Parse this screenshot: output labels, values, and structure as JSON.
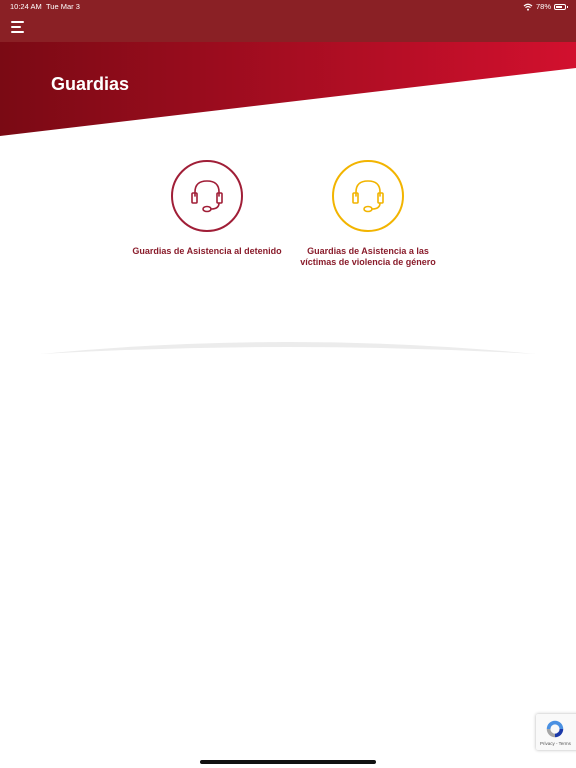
{
  "status_bar": {
    "time": "10:24 AM",
    "date": "Tue Mar 3",
    "battery_percent": "78%",
    "battery_level": 0.78
  },
  "header": {
    "title": "Guardias"
  },
  "cards": [
    {
      "label_line1": "Guardias de Asistencia al detenido",
      "label_line2": "",
      "icon": "headset-icon",
      "color": "#a01e37"
    },
    {
      "label_line1": "Guardias de Asistencia a las",
      "label_line2": "víctimas de violencia de género",
      "icon": "headset-icon",
      "color": "#f2b400"
    }
  ],
  "recaptcha": {
    "terms": "Privacy - Terms"
  },
  "colors": {
    "brand": "#8a2025",
    "hero_light": "#d0102f"
  }
}
